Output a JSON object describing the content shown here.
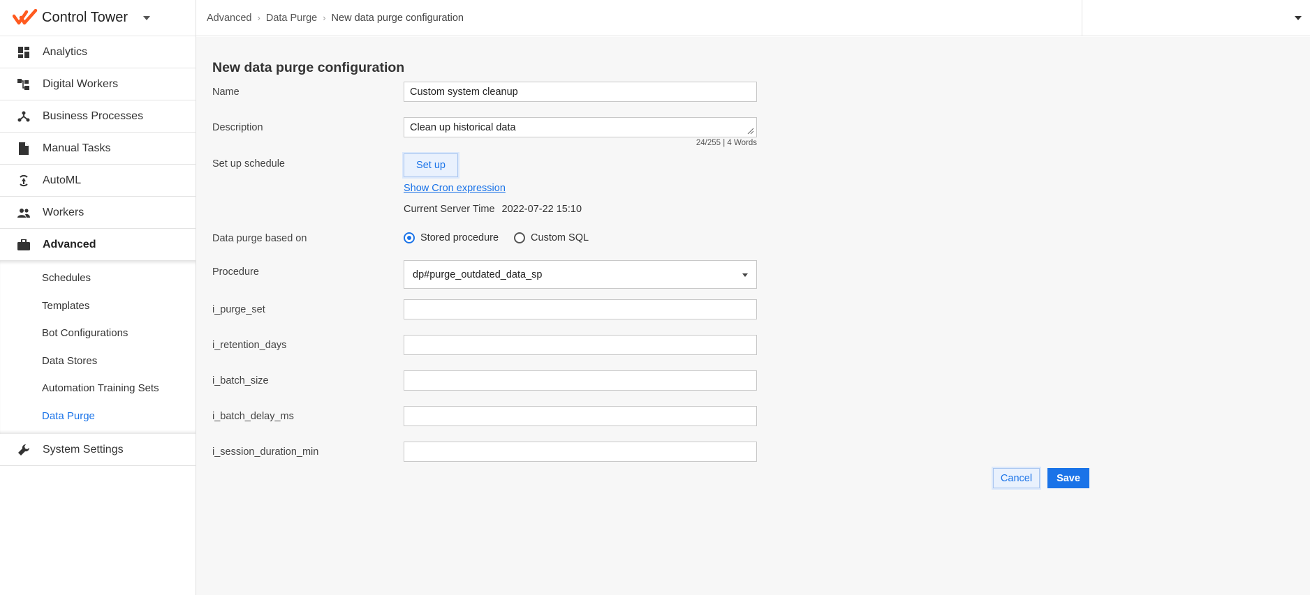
{
  "app": {
    "title": "Control Tower",
    "accent": "#1a73e8",
    "logo_color": "#ff5a1f"
  },
  "sidebar": {
    "items": [
      {
        "label": "Analytics",
        "icon": "dashboard-icon"
      },
      {
        "label": "Digital Workers",
        "icon": "digital-workers-icon"
      },
      {
        "label": "Business Processes",
        "icon": "process-graph-icon"
      },
      {
        "label": "Manual Tasks",
        "icon": "document-icon"
      },
      {
        "label": "AutoML",
        "icon": "automl-icon"
      },
      {
        "label": "Workers",
        "icon": "people-icon"
      },
      {
        "label": "Advanced",
        "icon": "briefcase-icon"
      }
    ],
    "advanced_sub": [
      "Schedules",
      "Templates",
      "Bot Configurations",
      "Data Stores",
      "Automation Training Sets",
      "Data Purge"
    ],
    "system_settings": {
      "label": "System Settings",
      "icon": "wrench-icon"
    }
  },
  "breadcrumb": {
    "items": [
      "Advanced",
      "Data Purge"
    ],
    "current": "New data purge configuration"
  },
  "form": {
    "title": "New data purge configuration",
    "name_label": "Name",
    "name_value": "Custom system cleanup",
    "description_label": "Description",
    "description_value": "Clean up historical data",
    "char_count": "24/255 | 4 Words",
    "schedule_label": "Set up schedule",
    "setup_button": "Set up",
    "cron_link": "Show Cron expression",
    "server_time_label": "Current Server Time",
    "server_time_value": "2022-07-22 15:10",
    "purge_based_label": "Data purge based on",
    "radio_stored": "Stored procedure",
    "radio_custom": "Custom SQL",
    "procedure_label": "Procedure",
    "procedure_value": "dp#purge_outdated_data_sp",
    "params": [
      {
        "label": "i_purge_set",
        "value": ""
      },
      {
        "label": "i_retention_days",
        "value": ""
      },
      {
        "label": "i_batch_size",
        "value": ""
      },
      {
        "label": "i_batch_delay_ms",
        "value": ""
      },
      {
        "label": "i_session_duration_min",
        "value": ""
      }
    ]
  },
  "actions": {
    "cancel": "Cancel",
    "save": "Save"
  }
}
